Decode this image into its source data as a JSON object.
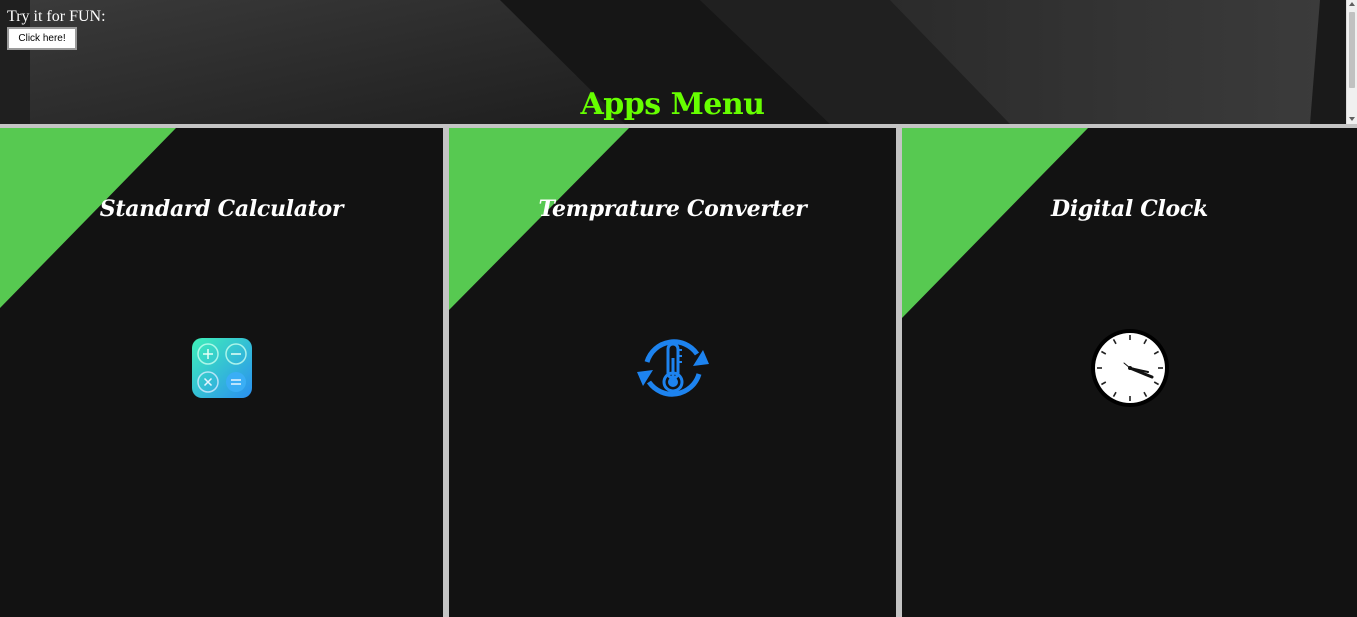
{
  "header": {
    "try_label": "Try it for FUN:",
    "button_label": "Click here!",
    "title": "Apps Menu",
    "title_color": "#66ff00"
  },
  "apps": [
    {
      "title": "Standard Calculator",
      "icon": "calculator-icon"
    },
    {
      "title": "Temprature Converter",
      "icon": "temperature-converter-icon"
    },
    {
      "title": "Digital Clock",
      "icon": "clock-icon"
    }
  ],
  "colors": {
    "accent_green": "#57c951",
    "card_background": "#121212",
    "divider": "#c4c4c4",
    "converter_blue": "#1d83ef"
  }
}
